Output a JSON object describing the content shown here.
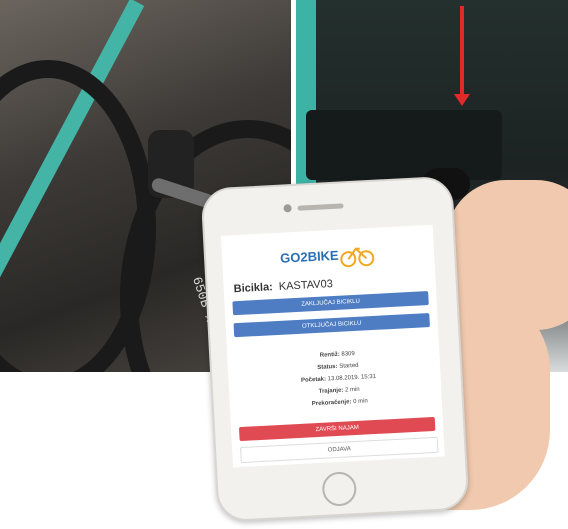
{
  "phone": {
    "logo_text": "GO2BIKE",
    "bike_label": "Bicikla:",
    "bike_name": "KASTAV03",
    "buttons": {
      "top_blue_1": "ZAKLJUČAJ BICIKLU",
      "top_blue_2": "OTKLJUČAJ BICIKLU",
      "red": "ZAVRŠI NAJAM",
      "white": "ODJAVA"
    },
    "info": [
      {
        "key": "Rentiž:",
        "value": "8309"
      },
      {
        "key": "Status:",
        "value": "Started"
      },
      {
        "key": "Početak:",
        "value": "13.08.2019. 15:31"
      },
      {
        "key": "Trajanje:",
        "value": "2 min"
      },
      {
        "key": "Prekoračenje:",
        "value": "0 min"
      }
    ]
  },
  "bike": {
    "tire_marking": "650B x"
  },
  "colors": {
    "teal_frame": "#44b4a6",
    "app_blue": "#4f7dc4",
    "app_red": "#e04a52",
    "arrow_red": "#e02a2a"
  }
}
